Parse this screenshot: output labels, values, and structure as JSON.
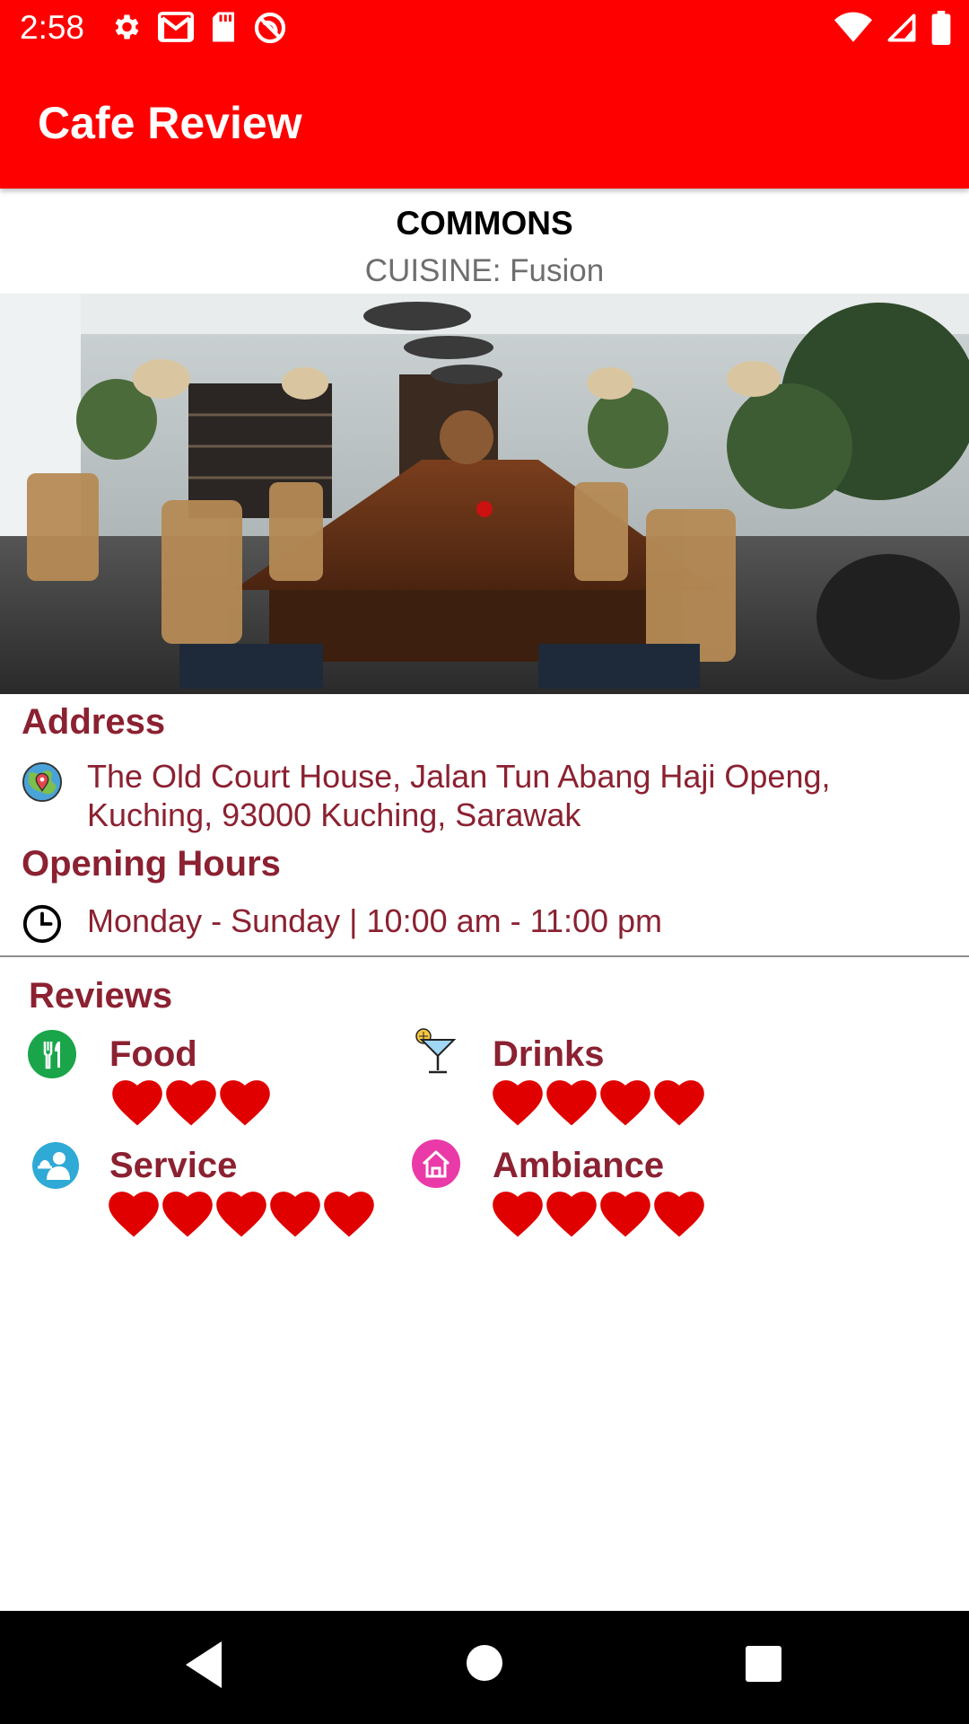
{
  "status_bar": {
    "time": "2:58",
    "left_icons": [
      "gear-icon",
      "gmail-icon",
      "sd-card-icon",
      "do-not-disturb-icon"
    ],
    "right_icons": [
      "wifi-icon",
      "cell-signal-icon",
      "battery-icon"
    ]
  },
  "app_bar": {
    "title": "Cafe Review",
    "color": "#ff0000"
  },
  "cafe": {
    "name": "COMMONS",
    "cuisine": "CUISINE: Fusion",
    "photo": "cafe-interior-photo"
  },
  "address": {
    "heading": "Address",
    "line1": "The Old Court House, Jalan Tun Abang Haji Openg,",
    "line2": "Kuching, 93000 Kuching, Sarawak",
    "icon": "globe-location-icon"
  },
  "opening_hours": {
    "heading": "Opening Hours",
    "text": "Monday - Sunday | 10:00 am - 11:00 pm",
    "icon": "clock-icon"
  },
  "reviews": {
    "heading": "Reviews",
    "accent_color": "#8b2131",
    "heart_color": "#e00000",
    "items": [
      {
        "label": "Food",
        "rating": 3,
        "icon": "fork-knife-icon"
      },
      {
        "label": "Drinks",
        "rating": 4,
        "icon": "cocktail-icon"
      },
      {
        "label": "Service",
        "rating": 5,
        "icon": "waiter-icon"
      },
      {
        "label": "Ambiance",
        "rating": 4,
        "icon": "house-icon"
      }
    ]
  },
  "nav_bar": {
    "buttons": [
      "back-icon",
      "home-icon",
      "recents-icon"
    ]
  }
}
